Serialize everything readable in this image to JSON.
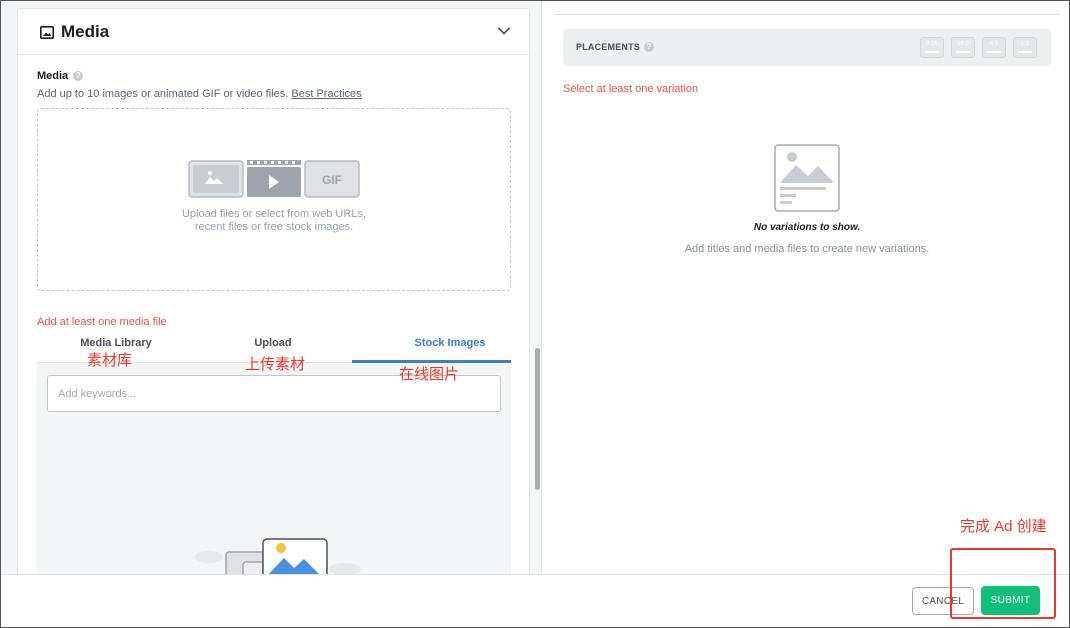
{
  "media_card": {
    "title": "Media",
    "title_icon": "image-icon",
    "collapse_icon": "chevron-down-icon",
    "field_label": "Media",
    "help_icon": "help-icon",
    "description": "Add up to 10 images or animated GIF or video files.",
    "best_practices_link": "Best Practices",
    "dropzone": {
      "line1": "Upload files or select from web URLs,",
      "line2": "recent files or free stock images.",
      "icons": [
        "image-icon",
        "video-icon",
        "gif-icon"
      ],
      "gif_label": "GIF"
    },
    "error": "Add at least one media file",
    "tabs": [
      {
        "label": "Media Library",
        "active": false
      },
      {
        "label": "Upload",
        "active": false
      },
      {
        "label": "Stock Images",
        "active": true
      }
    ],
    "keyword_placeholder": "Add keywords..."
  },
  "annotations": {
    "media_library": "素材库",
    "upload": "上传素材",
    "stock_images": "在线图片",
    "submit": "完成 Ad 创建"
  },
  "placements": {
    "label": "PLACEMENTS",
    "ratios": [
      "9:16",
      "16:9",
      "4:5",
      "1:1"
    ]
  },
  "variations": {
    "error": "Select at least one variation",
    "empty_title": "No variations to show.",
    "empty_subtitle": "Add titles and media files to create new variations."
  },
  "footer": {
    "cancel_label": "CANCEL",
    "submit_label": "SUBMIT"
  },
  "colors": {
    "accent": "#3b7bd9",
    "submit": "#0fbf7a",
    "error": "#e5534b",
    "annotation": "#e8382e"
  }
}
